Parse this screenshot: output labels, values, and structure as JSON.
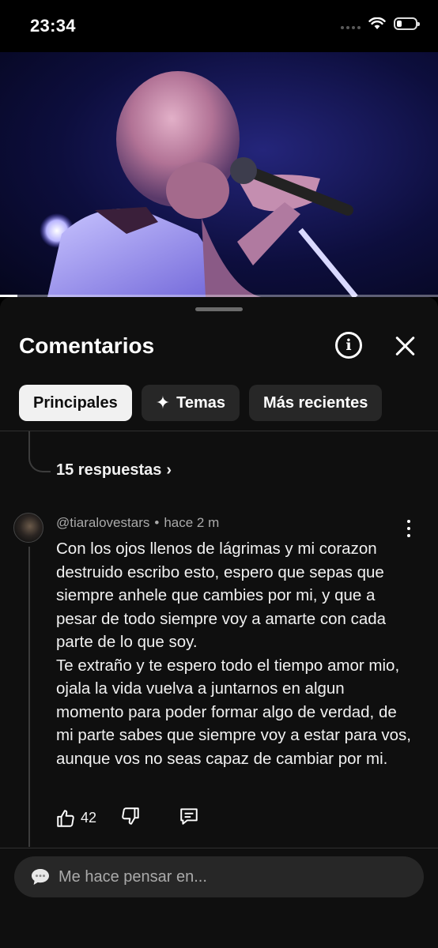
{
  "status_bar": {
    "time": "23:34",
    "battery_level": 0.25
  },
  "video": {
    "progress": 0.04
  },
  "comments_panel": {
    "title": "Comentarios",
    "filters": [
      {
        "label": "Principales",
        "active": true
      },
      {
        "label": "Temas",
        "icon": "sparkle-icon",
        "active": false
      },
      {
        "label": "Más recientes",
        "active": false
      }
    ],
    "replies_link": "15 respuestas",
    "comment": {
      "author": "@tiaralovestars",
      "separator": "•",
      "time": "hace 2 m",
      "text": "Con los ojos llenos de lágrimas y mi corazon destruido escribo esto, espero que sepas que siempre anhele que cambies por mi, y que a pesar de todo siempre voy a amarte con cada parte de lo que soy.\nTe extraño y te espero todo el tiempo amor mio, ojala la vida vuelva a juntarnos en algun momento para poder formar algo de verdad, de mi parte sabes que siempre voy a estar para vos, aunque vos no seas capaz de cambiar por mi.",
      "likes": "42"
    },
    "composer": {
      "placeholder": "Me hace pensar en..."
    }
  }
}
